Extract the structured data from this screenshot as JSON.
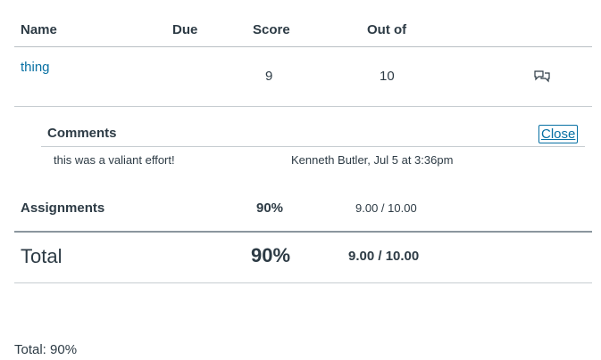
{
  "table": {
    "headers": {
      "name": "Name",
      "due": "Due",
      "score": "Score",
      "out_of": "Out of"
    },
    "rows": [
      {
        "name": "thing",
        "due": "",
        "score": "9",
        "out_of": "10",
        "icon": "comment-icon"
      }
    ]
  },
  "comments": {
    "title": "Comments",
    "close_label": "Close",
    "items": [
      {
        "text": "this was a valiant effort!",
        "author_date": "Kenneth Butler, Jul 5 at 3:36pm"
      }
    ]
  },
  "groups": [
    {
      "name": "Assignments",
      "percent": "90%",
      "points": "9.00 / 10.00"
    }
  ],
  "total": {
    "label": "Total",
    "percent": "90%",
    "points": "9.00 / 10.00"
  },
  "footer": {
    "text": "Total: 90%"
  },
  "colors": {
    "link": "#0770a3",
    "text": "#2d3b45",
    "divider": "#c7cdd1"
  }
}
